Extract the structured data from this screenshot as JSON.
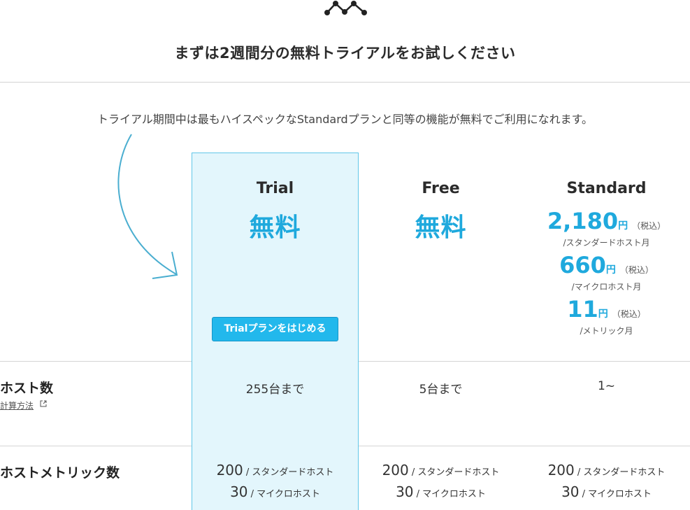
{
  "brand": {
    "logo_icon": "mackerel-logo-icon",
    "accent": "#1fa9dd"
  },
  "headline": "まずは2週間分の無料トライアルをお試しください",
  "intro": "トライアル期間中は最もハイスペックなStandardプランと同等の機能が無料でご利用になれます。",
  "plans": [
    {
      "name": "Trial",
      "price": "無料",
      "cta": "Trialプランをはじめる"
    },
    {
      "name": "Free",
      "price": "無料"
    },
    {
      "name": "Standard",
      "prices": [
        {
          "amount": "2,180",
          "currency": "円",
          "tax": "（税込）",
          "unit": "/スタンダードホスト月"
        },
        {
          "amount": "660",
          "currency": "円",
          "tax": "（税込）",
          "unit": "/マイクロホスト月"
        },
        {
          "amount": "11",
          "currency": "円",
          "tax": "（税込）",
          "unit": "/メトリック月"
        }
      ]
    }
  ],
  "rows": {
    "hosts": {
      "label": "ホスト数",
      "link": "計算方法",
      "values": [
        "255台まで",
        "5台まで",
        "1~"
      ]
    },
    "host_metrics": {
      "label": "ホストメトリック数",
      "values": [
        {
          "standard_count": "200",
          "standard_unit": " / スタンダードホスト",
          "micro_count": "30",
          "micro_unit": " / マイクロホスト"
        },
        {
          "standard_count": "200",
          "standard_unit": " / スタンダードホスト",
          "micro_count": "30",
          "micro_unit": " / マイクロホスト"
        },
        {
          "standard_count": "200",
          "standard_unit": " / スタンダードホスト",
          "micro_count": "30",
          "micro_unit": " / マイクロホスト"
        }
      ]
    }
  }
}
